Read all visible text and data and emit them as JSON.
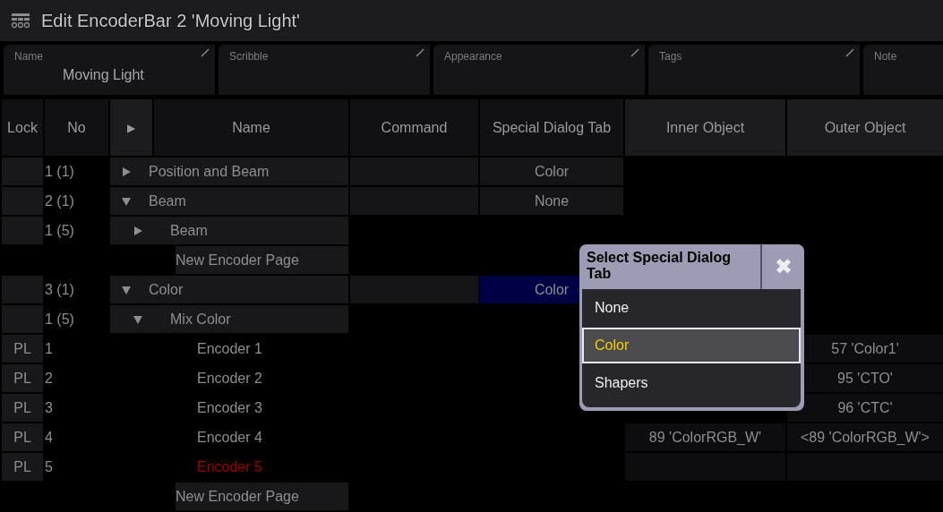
{
  "window": {
    "title": "Edit EncoderBar 2 'Moving Light'"
  },
  "fields": [
    {
      "label": "Name",
      "value": "Moving Light",
      "editable": true
    },
    {
      "label": "Scribble",
      "editable": true
    },
    {
      "label": "Appearance",
      "editable": true
    },
    {
      "label": "Tags",
      "editable": true
    },
    {
      "label": "Note",
      "editable": false
    }
  ],
  "table": {
    "columns": [
      "Lock",
      "No",
      "▶",
      "Name",
      "Command",
      "Special Dialog Tab",
      "Inner Object",
      "Outer Object"
    ],
    "rows": [
      {
        "kind": "group",
        "no": "1 (1)",
        "name": "Position and Beam",
        "expanded": false,
        "special_dialog_tab": "Color",
        "selected": false
      },
      {
        "kind": "group",
        "no": "2 (1)",
        "name": "Beam",
        "expanded": true,
        "special_dialog_tab": "None",
        "selected": false,
        "children": [
          {
            "kind": "group",
            "no": "1 (5)",
            "name": "Beam",
            "expanded": false
          },
          {
            "kind": "new_page",
            "name": "New Encoder Page"
          }
        ]
      },
      {
        "kind": "group",
        "no": "3 (1)",
        "name": "Color",
        "expanded": true,
        "special_dialog_tab": "Color",
        "selected": true,
        "children": [
          {
            "kind": "group",
            "no": "1 (5)",
            "name": "Mix Color",
            "expanded": true,
            "children": [
              {
                "kind": "encoder",
                "lock": "PL",
                "no": "1",
                "name": "Encoder 1",
                "error": false,
                "outer_object": "57 'Color1'"
              },
              {
                "kind": "encoder",
                "lock": "PL",
                "no": "2",
                "name": "Encoder 2",
                "error": false,
                "outer_object": "95 'CTO'"
              },
              {
                "kind": "encoder",
                "lock": "PL",
                "no": "3",
                "name": "Encoder 3",
                "error": false,
                "outer_object": "96 'CTC'"
              },
              {
                "kind": "encoder",
                "lock": "PL",
                "no": "4",
                "name": "Encoder 4",
                "error": false,
                "inner_object": "89 'ColorRGB_W'",
                "outer_object": "<89 'ColorRGB_W'>"
              },
              {
                "kind": "encoder",
                "lock": "PL",
                "no": "5",
                "name": "Encoder 5",
                "error": true
              }
            ]
          },
          {
            "kind": "new_page",
            "name": "New Encoder Page"
          }
        ]
      }
    ]
  },
  "dialog": {
    "title": "Select Special Dialog Tab",
    "close": "✖",
    "options": [
      {
        "label": "None",
        "selected": false
      },
      {
        "label": "Color",
        "selected": true
      },
      {
        "label": "Shapers",
        "selected": false
      }
    ]
  }
}
